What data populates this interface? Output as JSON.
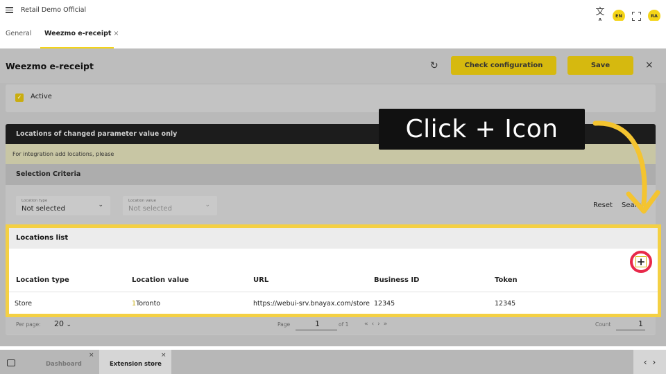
{
  "topbar": {
    "app_title": "Retail Demo Official",
    "lang": "EN",
    "avatar_initials": "RA"
  },
  "tabs": {
    "general": "General",
    "active_tab": "Weezmo e-receipt",
    "close": "×"
  },
  "page": {
    "title": "Weezmo e-receipt",
    "check_configuration": "Check configuration",
    "save": "Save",
    "close": "×"
  },
  "active_section": {
    "label": "Active",
    "checked": true
  },
  "panel": {
    "title": "Locations of changed parameter value only",
    "info": "For integration add locations, please",
    "selection_criteria": "Selection Criteria",
    "location_type": {
      "label": "Location type",
      "value": "Not selected"
    },
    "location_value": {
      "label": "Location value",
      "value": "Not selected"
    },
    "reset": "Reset",
    "search": "Search"
  },
  "locations_list": {
    "title": "Locations list",
    "columns": [
      "Location type",
      "Location value",
      "URL",
      "Business ID",
      "Token"
    ],
    "rows": [
      {
        "location_type": "Store",
        "location_value_num": "1",
        "location_value": "Toronto",
        "url": "https://webui-srv.bnayax.com/store",
        "business_id": "12345",
        "token": "12345"
      }
    ]
  },
  "pager": {
    "per_page_label": "Per page:",
    "per_page": "20",
    "page_label": "Page",
    "page": "1",
    "of_label": "of 1",
    "count_label": "Count",
    "count": "1"
  },
  "dock": {
    "tabs": [
      "Dashboard",
      "Extension store"
    ]
  },
  "callout": {
    "text": "Click + Icon"
  },
  "colors": {
    "accent_yellow": "#f4d417",
    "highlight_border": "#f4d043",
    "callout_circle": "#e8294a"
  }
}
